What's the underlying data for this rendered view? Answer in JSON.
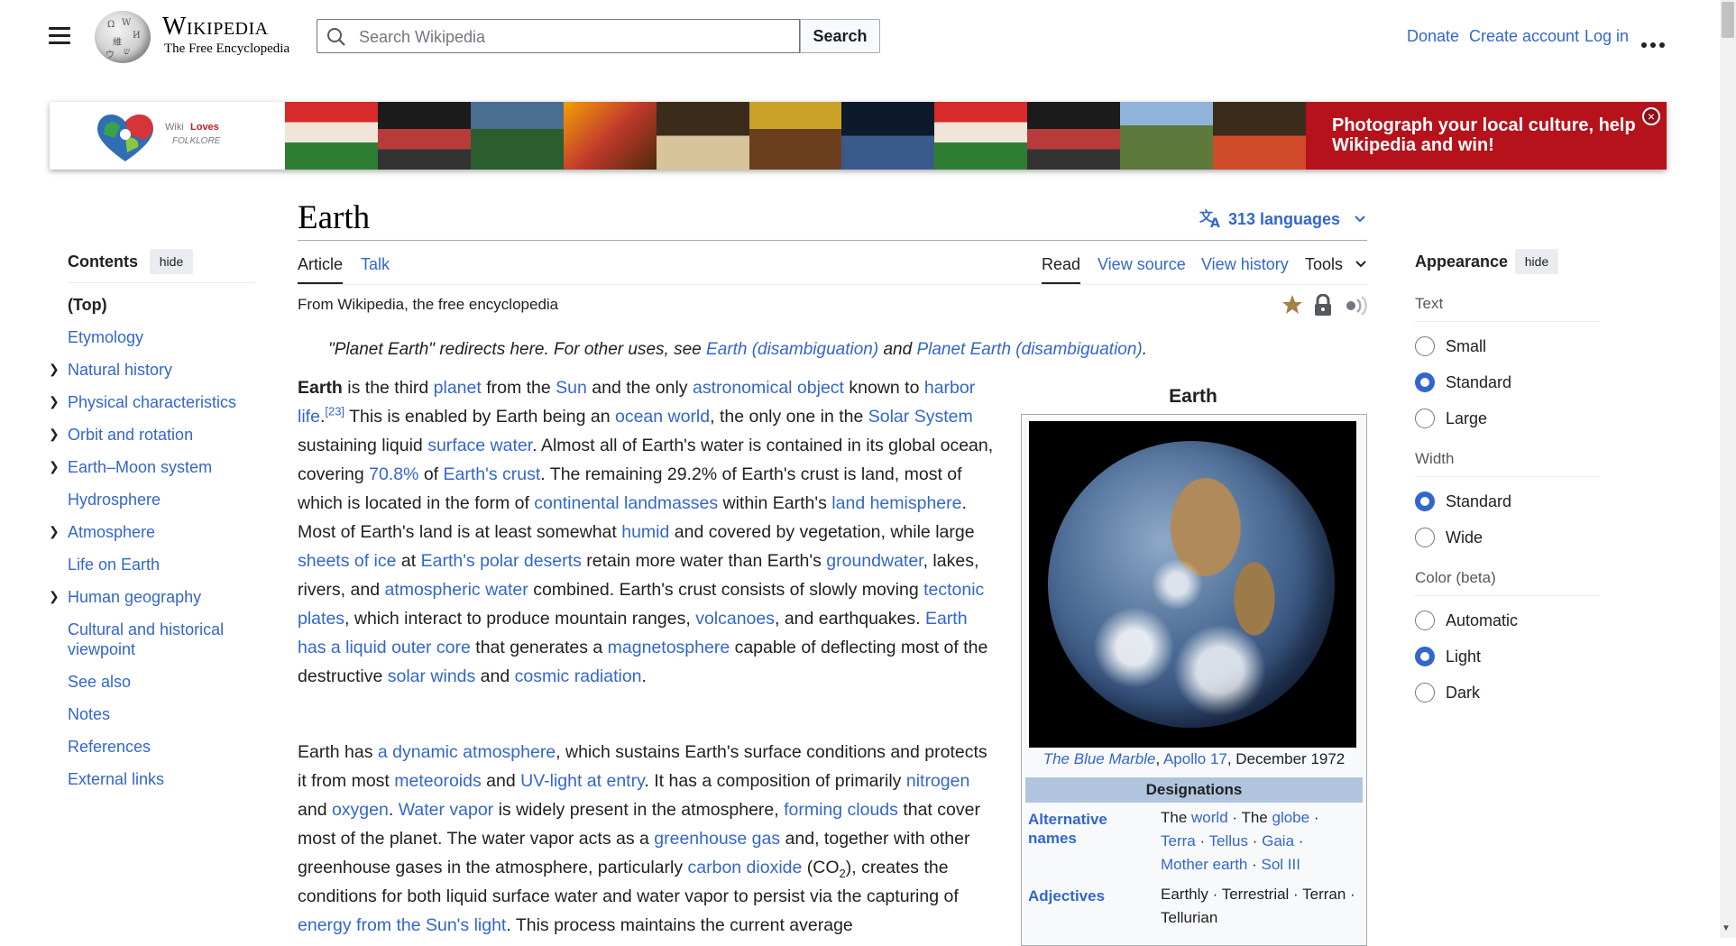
{
  "header": {
    "wordmark": "Wikipedia",
    "tagline": "The Free Encyclopedia",
    "search_placeholder": "Search Wikipedia",
    "search_button": "Search",
    "links": {
      "donate": "Donate",
      "create_account": "Create account",
      "login": "Log in"
    }
  },
  "banner": {
    "logo_text_1": "Wiki",
    "logo_text_2": "Loves",
    "logo_text_3": "FOLKLORE",
    "promo": "Photograph your local culture, help Wikipedia and win!",
    "close": "×"
  },
  "page": {
    "title": "Earth",
    "languages": "313 languages",
    "tabs": {
      "article": "Article",
      "talk": "Talk",
      "read": "Read",
      "view_source": "View source",
      "view_history": "View history",
      "tools": "Tools"
    },
    "from": "From Wikipedia, the free encyclopedia"
  },
  "hatnote": {
    "pre": "\"Planet Earth\" redirects here. For other uses, see ",
    "link1": "Earth (disambiguation)",
    "mid": " and ",
    "link2": "Planet Earth (disambiguation)",
    "end": "."
  },
  "toc": {
    "heading": "Contents",
    "hide": "hide",
    "items": [
      "(Top)",
      "Etymology",
      "Natural history",
      "Physical characteristics",
      "Orbit and rotation",
      "Earth–Moon system",
      "Hydrosphere",
      "Atmosphere",
      "Life on Earth",
      "Human geography",
      "Cultural and historical viewpoint",
      "See also",
      "Notes",
      "References",
      "External links"
    ]
  },
  "infobox": {
    "title": "Earth",
    "caption_link1": "The Blue Marble",
    "caption_sep": ", ",
    "caption_link2": "Apollo 17",
    "caption_end": ", December 1972",
    "section": "Designations",
    "alt_label": "Alternative names",
    "adj_label": "Adjectives",
    "alt_values": {
      "t1": "The ",
      "world": "world",
      "t2": " · The ",
      "globe": "globe",
      "t3": " ·",
      "terra": "Terra",
      "d1": " · ",
      "tellus": "Tellus",
      "d2": " · ",
      "gaia": "Gaia",
      "d3": " ·",
      "mother": "Mother earth",
      "d4": " · ",
      "sol": "Sol III"
    },
    "adj_values": "Earthly · Terrestrial · Terran · Tellurian"
  },
  "appearance": {
    "heading": "Appearance",
    "hide": "hide",
    "text_label": "Text",
    "text_options": [
      "Small",
      "Standard",
      "Large"
    ],
    "text_selected": "Standard",
    "width_label": "Width",
    "width_options": [
      "Standard",
      "Wide"
    ],
    "width_selected": "Standard",
    "color_label": "Color (beta)",
    "color_options": [
      "Automatic",
      "Light",
      "Dark"
    ],
    "color_selected": "Light"
  },
  "colors": {
    "link": "#3366cc",
    "banner_red": "#b5121b",
    "infobox_section": "#b0c4de"
  }
}
